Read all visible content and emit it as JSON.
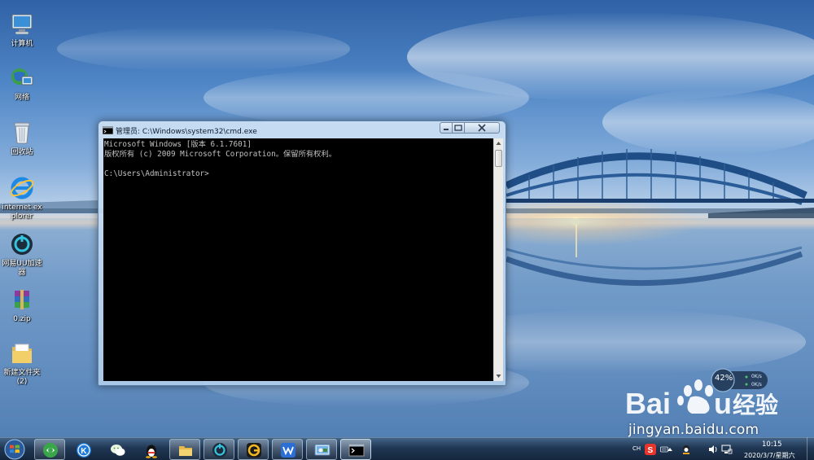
{
  "desktop_icons": [
    {
      "name": "computer",
      "label": "计算机"
    },
    {
      "name": "network",
      "label": "网络"
    },
    {
      "name": "recycle-bin",
      "label": "回收站"
    },
    {
      "name": "internet-explorer",
      "label": "internet explorer"
    },
    {
      "name": "netease-uu",
      "label": "网易UU加速器"
    },
    {
      "name": "zip-file",
      "label": "0.zip"
    },
    {
      "name": "new-folder",
      "label": "新建文件夹 (2)"
    }
  ],
  "cmd_window": {
    "title": "管理员: C:\\Windows\\system32\\cmd.exe",
    "lines": [
      "Microsoft Windows [版本 6.1.7601]",
      "版权所有 (c) 2009 Microsoft Corporation。保留所有权利。",
      "",
      "C:\\Users\\Administrator>"
    ]
  },
  "net_widget": {
    "percent": "42%",
    "up_rate": "0K/s",
    "down_rate": "0K/s"
  },
  "watermark": {
    "url": "jingyan.baidu.com"
  },
  "taskbar": {
    "items": [
      {
        "name": "browser",
        "state": "open"
      },
      {
        "name": "kugou",
        "state": "pinned"
      },
      {
        "name": "wechat",
        "state": "pinned"
      },
      {
        "name": "qq",
        "state": "pinned"
      },
      {
        "name": "explorer",
        "state": "open"
      },
      {
        "name": "uu",
        "state": "open"
      },
      {
        "name": "game",
        "state": "open"
      },
      {
        "name": "wps",
        "state": "open"
      },
      {
        "name": "control-panel",
        "state": "open"
      },
      {
        "name": "cmd",
        "state": "active"
      }
    ],
    "tray": {
      "ime": "CH",
      "time": "10:15",
      "date": "2020/3/7/星期六"
    }
  },
  "colors": {
    "console_bg": "#000000",
    "console_text": "#c0c0c0",
    "taskbar": "#1a2f48"
  }
}
